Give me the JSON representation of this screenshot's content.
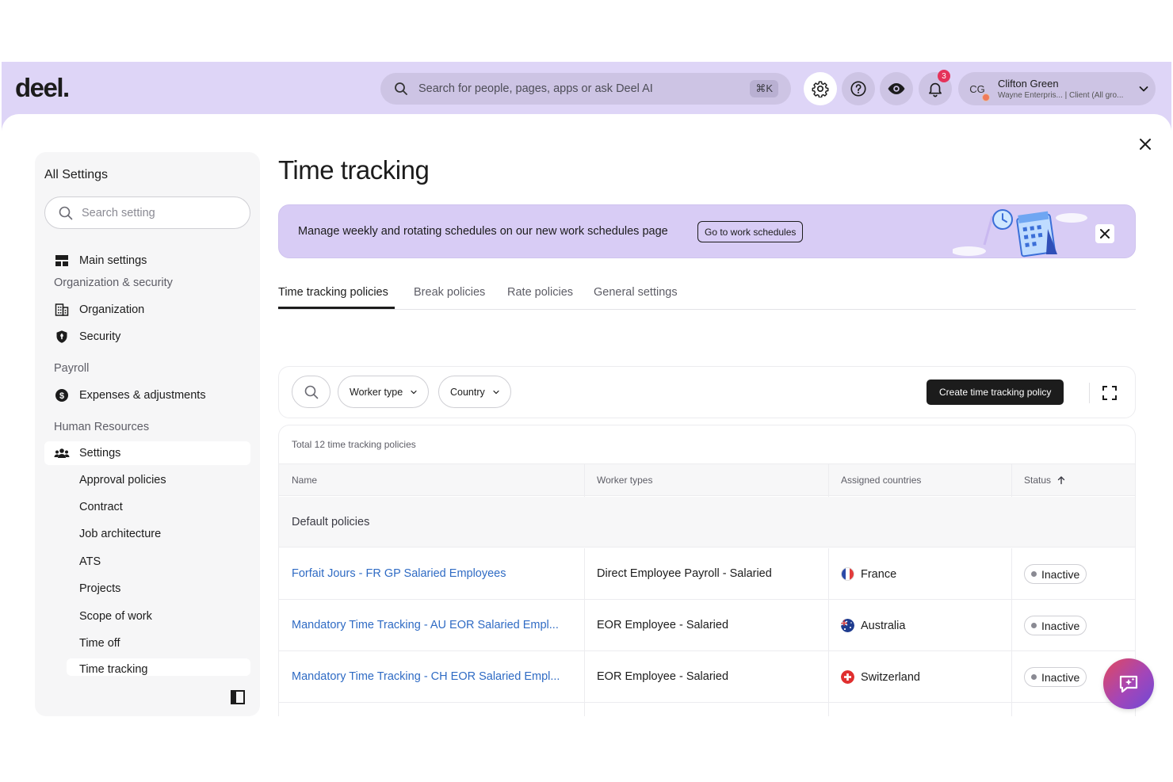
{
  "header": {
    "logo": "deel.",
    "search_placeholder": "Search for people, pages, apps or ask Deel AI",
    "search_shortcut": "⌘K",
    "notifications_count": "3",
    "user": {
      "initials": "CG",
      "name": "Clifton Green",
      "role": "Wayne Enterpris... | Client (All gro..."
    }
  },
  "sidebar": {
    "title": "All Settings",
    "search_placeholder": "Search setting",
    "main_settings": "Main settings",
    "groups": {
      "org_security": "Organization & security",
      "payroll": "Payroll",
      "hr": "Human Resources"
    },
    "items": {
      "organization": "Organization",
      "security": "Security",
      "expenses": "Expenses & adjustments",
      "settings": "Settings"
    },
    "sub_items": [
      "Approval policies",
      "Contract",
      "Job architecture",
      "ATS",
      "Projects",
      "Scope of work",
      "Time off",
      "Time tracking"
    ]
  },
  "page": {
    "title": "Time tracking",
    "banner": {
      "text": "Manage weekly and rotating schedules on our new work schedules page",
      "button": "Go to work schedules"
    },
    "tabs": [
      "Time tracking policies",
      "Break policies",
      "Rate policies",
      "General settings"
    ],
    "filters": {
      "worker_type": "Worker type",
      "country": "Country"
    },
    "create_button": "Create time tracking policy",
    "total_text": "Total 12 time tracking policies",
    "columns": {
      "name": "Name",
      "worker_types": "Worker types",
      "countries": "Assigned countries",
      "status": "Status"
    },
    "group_label": "Default policies",
    "rows": [
      {
        "name": "Forfait Jours - FR GP Salaried Employees",
        "worker_type": "Direct Employee Payroll - Salaried",
        "country": "France",
        "status": "Inactive"
      },
      {
        "name": "Mandatory Time Tracking - AU EOR Salaried Empl...",
        "worker_type": "EOR Employee - Salaried",
        "country": "Australia",
        "status": "Inactive"
      },
      {
        "name": "Mandatory Time Tracking - CH EOR Salaried Empl...",
        "worker_type": "EOR Employee - Salaried",
        "country": "Switzerland",
        "status": "Inactive"
      }
    ]
  },
  "colors": {
    "header_bg": "#ded5f7",
    "banner_bg": "#d8ccf5",
    "link": "#2f6bc4",
    "primary_button": "#1c1c1c",
    "badge": "#e5325a"
  },
  "icons": [
    "search-icon",
    "gear-icon",
    "help-icon",
    "eye-icon",
    "bell-icon",
    "chevron-down-icon",
    "close-icon",
    "layout-icon",
    "building-icon",
    "shield-icon",
    "dollar-icon",
    "people-icon",
    "sidebar-collapse-icon",
    "expand-icon",
    "sort-up-icon",
    "ai-chat-icon"
  ]
}
